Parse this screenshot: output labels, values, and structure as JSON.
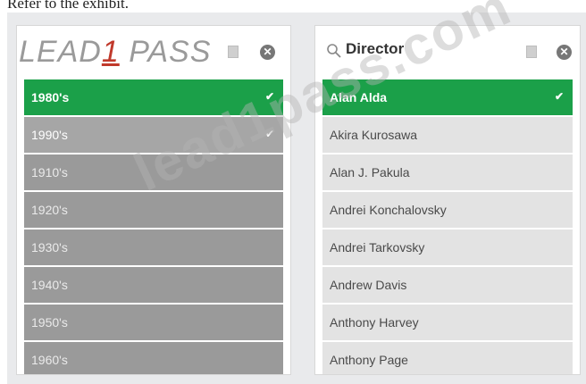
{
  "caption": "Refer to the exhibit.",
  "logo": {
    "text_a": "LEAD",
    "text_one": "1",
    "text_b": " PASS"
  },
  "watermark": "lead1pass.com",
  "decade_panel": {
    "items": [
      {
        "label": "1980's",
        "state": "selected"
      },
      {
        "label": "1990's",
        "state": "alternative"
      },
      {
        "label": "1910's",
        "state": "excluded"
      },
      {
        "label": "1920's",
        "state": "excluded"
      },
      {
        "label": "1930's",
        "state": "excluded"
      },
      {
        "label": "1940's",
        "state": "excluded"
      },
      {
        "label": "1950's",
        "state": "excluded"
      },
      {
        "label": "1960's",
        "state": "excluded"
      }
    ]
  },
  "director_panel": {
    "title": "Director",
    "items": [
      {
        "label": "Alan Alda",
        "state": "selected"
      },
      {
        "label": "Akira Kurosawa",
        "state": "possible"
      },
      {
        "label": "Alan J. Pakula",
        "state": "possible"
      },
      {
        "label": "Andrei Konchalovsky",
        "state": "possible"
      },
      {
        "label": "Andrei Tarkovsky",
        "state": "possible"
      },
      {
        "label": "Andrew Davis",
        "state": "possible"
      },
      {
        "label": "Anthony Harvey",
        "state": "possible"
      },
      {
        "label": "Anthony Page",
        "state": "possible"
      }
    ]
  },
  "colors": {
    "selected": "#1ba049",
    "alternative": "#a6a6a6",
    "excluded": "#9a9a9a",
    "possible": "#e3e3e3"
  },
  "check_glyph": "✔",
  "close_glyph": "✕"
}
